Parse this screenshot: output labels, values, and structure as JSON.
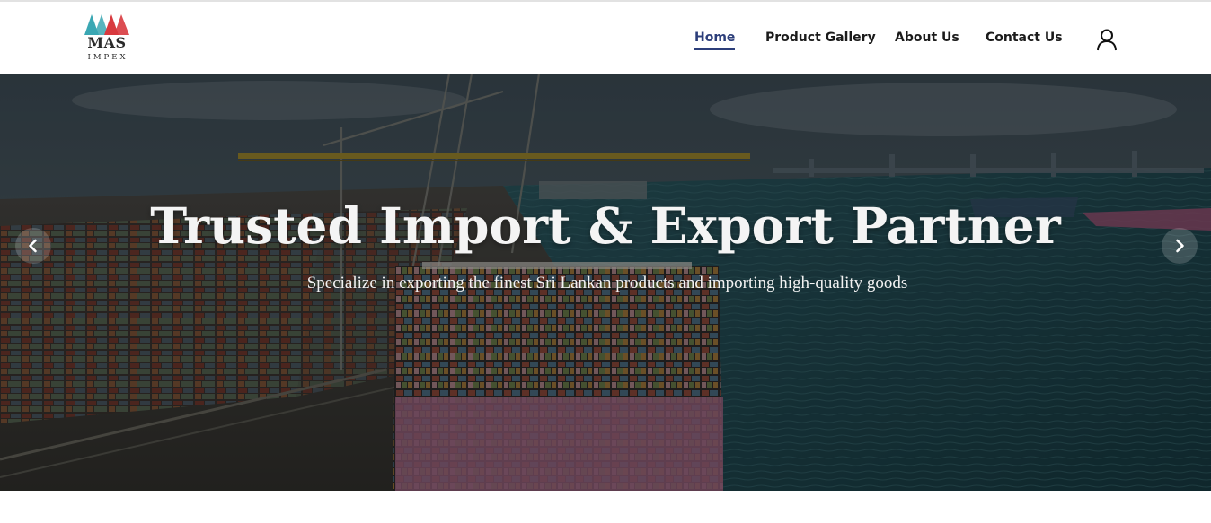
{
  "brand": {
    "logo_main": "MAS",
    "logo_sub": "IMPEX",
    "colors": {
      "teal": "#3aa7b3",
      "red": "#d83a3f",
      "dark": "#2a2a2a"
    }
  },
  "nav": {
    "items": [
      {
        "label": "Home",
        "active": true
      },
      {
        "label": "Product Gallery",
        "active": false
      },
      {
        "label": "About Us",
        "active": false
      },
      {
        "label": "Contact Us",
        "active": false
      }
    ],
    "user_icon": "user-icon",
    "active_color": "#2c3e7a"
  },
  "hero": {
    "title": "Trusted Import & Export Partner",
    "subtitle": "Specialize in exporting the finest Sri Lankan products and importing high-quality goods",
    "background": "container-port-with-cargo-ship",
    "prev_icon": "chevron-left-icon",
    "next_icon": "chevron-right-icon"
  }
}
